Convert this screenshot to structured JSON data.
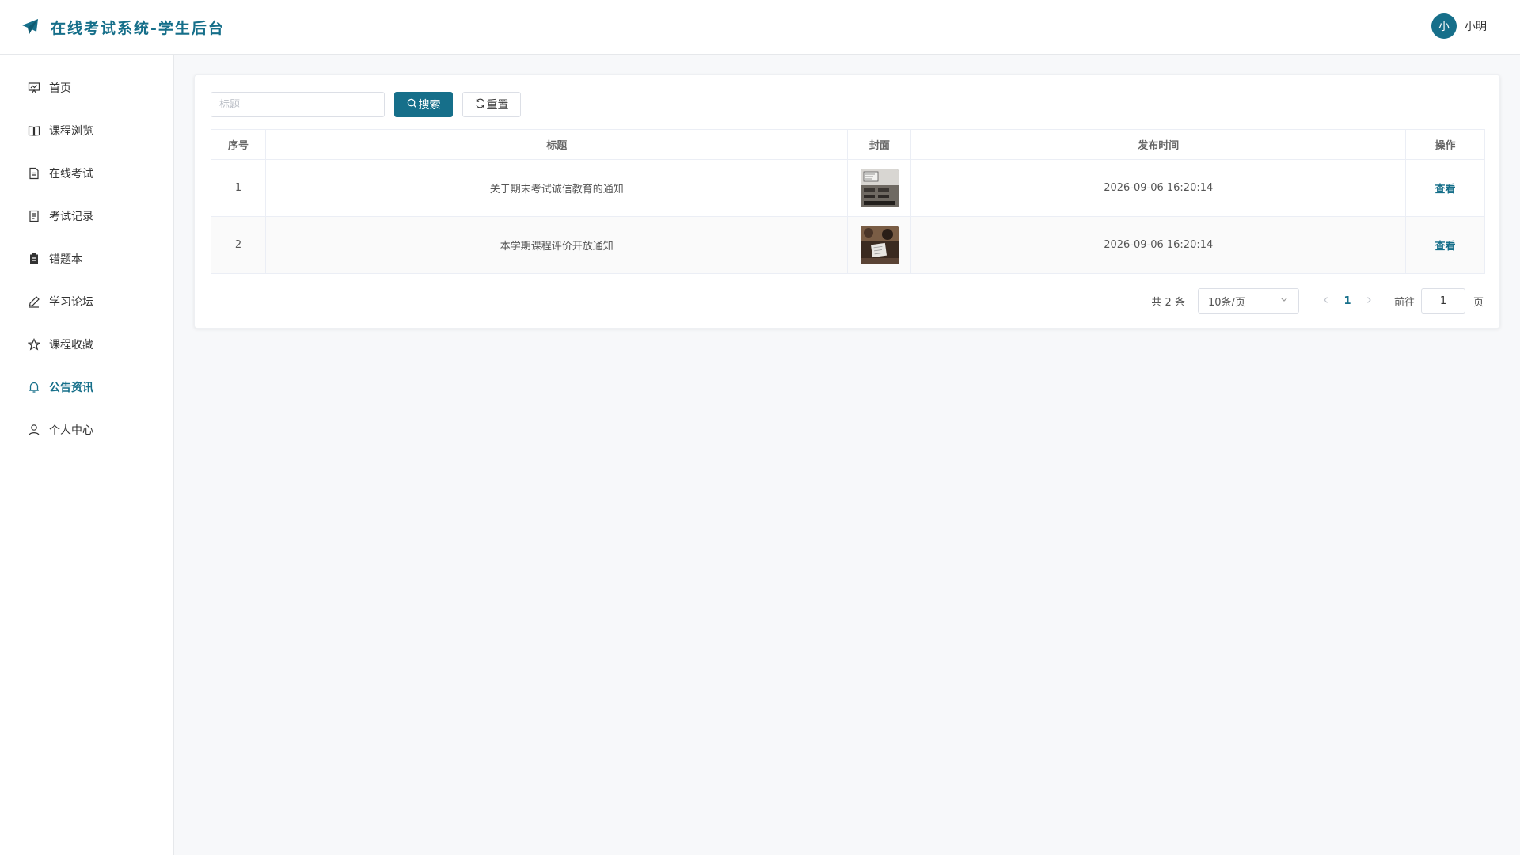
{
  "header": {
    "title": "在线考试系统-学生后台",
    "logo_icon": "paper-plane-icon",
    "user": {
      "avatar_text": "小",
      "name": "小明"
    }
  },
  "sidebar": {
    "items": [
      {
        "label": "首页",
        "icon": "presentation-icon",
        "active": false
      },
      {
        "label": "课程浏览",
        "icon": "book-open-icon",
        "active": false
      },
      {
        "label": "在线考试",
        "icon": "document-icon",
        "active": false
      },
      {
        "label": "考试记录",
        "icon": "document-list-icon",
        "active": false
      },
      {
        "label": "错题本",
        "icon": "clipboard-icon",
        "active": false
      },
      {
        "label": "学习论坛",
        "icon": "edit-pen-icon",
        "active": false
      },
      {
        "label": "课程收藏",
        "icon": "star-icon",
        "active": false
      },
      {
        "label": "公告资讯",
        "icon": "bell-icon",
        "active": true
      },
      {
        "label": "个人中心",
        "icon": "user-icon",
        "active": false
      }
    ]
  },
  "toolbar": {
    "search_placeholder": "标题",
    "search_value": "",
    "search_label": "搜索",
    "reset_label": "重置"
  },
  "table": {
    "columns": [
      "序号",
      "标题",
      "封面",
      "发布时间",
      "操作"
    ],
    "rows": [
      {
        "index": "1",
        "title": "关于期末考试诚信教育的通知",
        "cover": "classroom-photo",
        "time": "2026-09-06 16:20:14",
        "action": "查看"
      },
      {
        "index": "2",
        "title": "本学期课程评价开放通知",
        "cover": "student-photo",
        "time": "2026-09-06 16:20:14",
        "action": "查看"
      }
    ]
  },
  "pagination": {
    "total_text": "共 2 条",
    "page_size": "10条/页",
    "current_page": "1",
    "goto_label": "前往",
    "goto_value": "1",
    "goto_suffix": "页"
  },
  "colors": {
    "accent": "#166f8a"
  }
}
